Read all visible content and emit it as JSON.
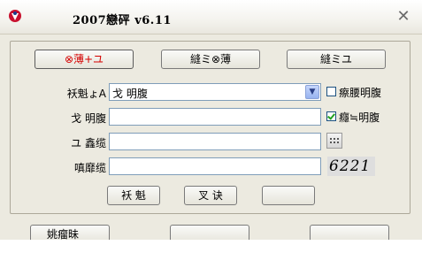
{
  "window": {
    "title": "2007戀砰  v6.11",
    "close_glyph": "✕"
  },
  "modes": {
    "tab1": "⊗薄+ユ",
    "tab2": "縫ミ⊗薄",
    "tab3": "縫ミユ"
  },
  "form": {
    "type_label": "袄魁ょA",
    "type_value": "戈  明腹",
    "checkbox1_label": "瘵腰明腹",
    "account_label": "戈  明腹",
    "account_value": "",
    "checkbox2_label": "癮≒明腹",
    "password_label": "ユ  鑫缆",
    "password_value": "",
    "code_label": "嗔靡缆",
    "code_value": "",
    "captcha": "6221"
  },
  "actions": {
    "login": "袄 魁",
    "cancel": "叉 诀",
    "third": ""
  },
  "bottom": {
    "left_button": "姚瘤昧"
  },
  "colors": {
    "active_tab_text": "#d40000",
    "checkmark": "#21a121"
  }
}
